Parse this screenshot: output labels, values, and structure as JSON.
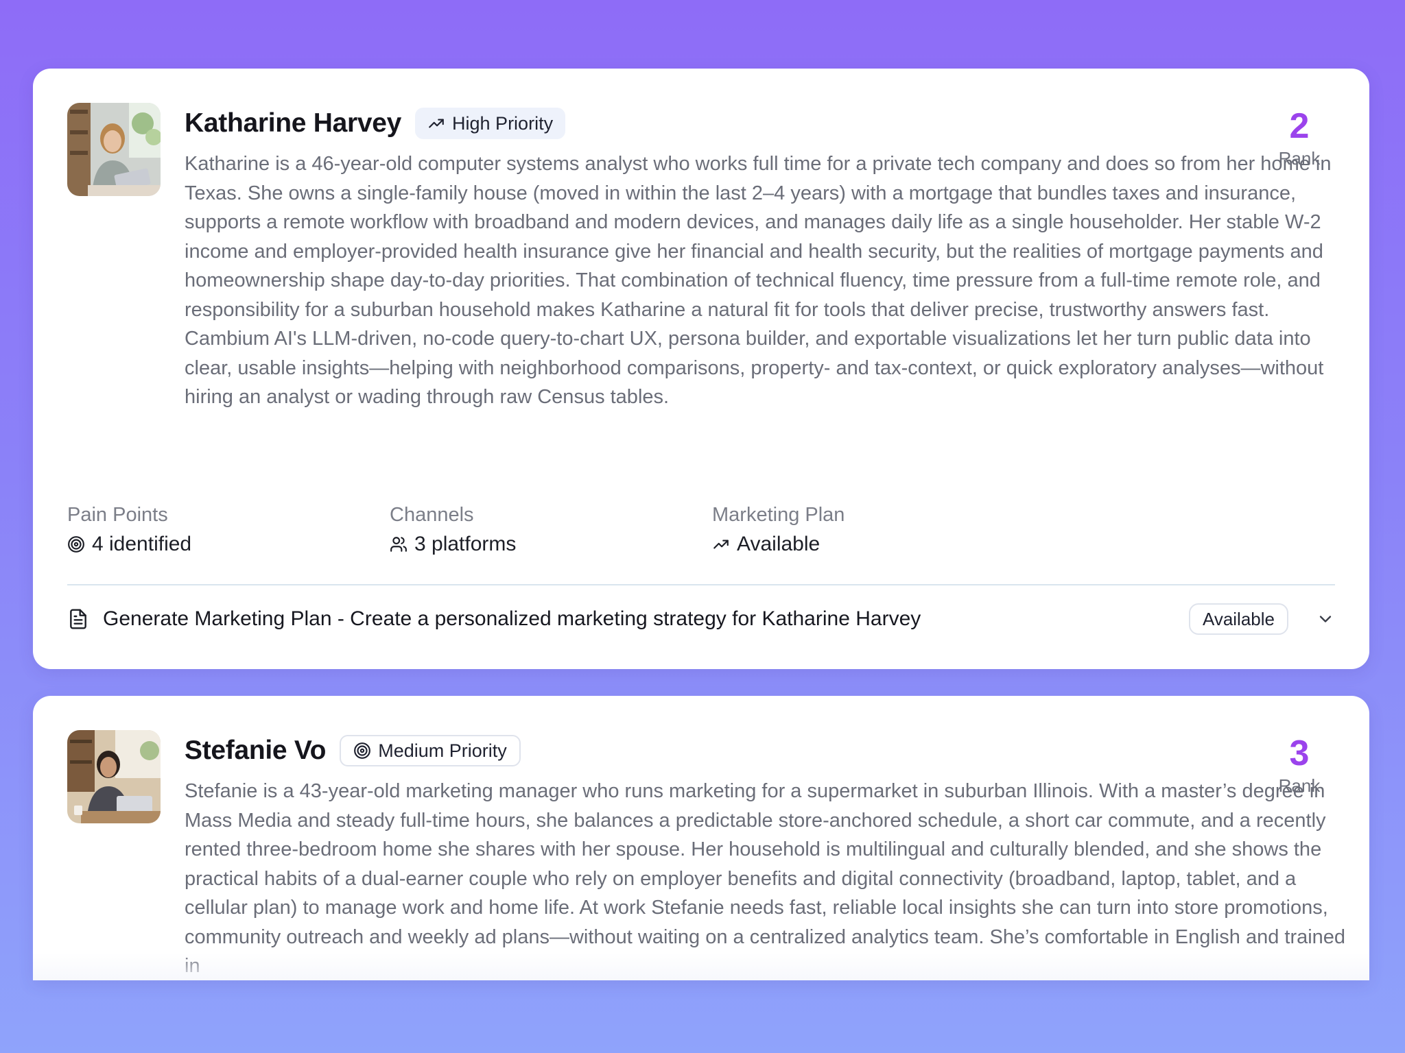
{
  "personas": [
    {
      "name": "Katharine Harvey",
      "priority": "High Priority",
      "priority_icon": "trending-up-icon",
      "rank_value": "2",
      "rank_label": "Rank",
      "description": "Katharine is a 46-year-old computer systems analyst who works full time for a private tech company and does so from her home in Texas. She owns a single-family house (moved in within the last 2–4 years) with a mortgage that bundles taxes and insurance, supports a remote workflow with broadband and modern devices, and manages daily life as a single householder. Her stable W-2 income and employer-provided health insurance give her financial and health security, but the realities of mortgage payments and homeownership shape day-to-day priorities. That combination of technical fluency, time pressure from a full-time remote role, and responsibility for a suburban household makes Katharine a natural fit for tools that deliver precise, trustworthy answers fast. Cambium AI's LLM-driven, no-code query-to-chart UX, persona builder, and exportable visualizations let her turn public data into clear, usable insights—helping with neighborhood comparisons, property- and tax-context, or quick exploratory analyses—without hiring an analyst or wading through raw Census tables.",
      "stats": [
        {
          "label": "Pain Points",
          "value": "4 identified",
          "icon": "target-icon"
        },
        {
          "label": "Channels",
          "value": "3 platforms",
          "icon": "users-icon"
        },
        {
          "label": "Marketing Plan",
          "value": "Available",
          "icon": "trending-up-icon"
        }
      ],
      "plan_title": "Generate Marketing Plan - Create a personalized marketing strategy for Katharine Harvey",
      "plan_status": "Available"
    },
    {
      "name": "Stefanie Vo",
      "priority": "Medium Priority",
      "priority_icon": "target-icon",
      "rank_value": "3",
      "rank_label": "Rank",
      "description": "Stefanie is a 43-year-old marketing manager who runs marketing for a supermarket in suburban Illinois. With a master’s degree in Mass Media and steady full-time hours, she balances a predictable store-anchored schedule, a short car commute, and a recently rented three-bedroom home she shares with her spouse. Her household is multilingual and culturally blended, and she shows the practical habits of a dual-earner couple who rely on employer benefits and digital connectivity (broadband, laptop, tablet, and a cellular plan) to manage work and home life. At work Stefanie needs fast, reliable local insights she can turn into store promotions, community outreach and weekly ad plans—without waiting on a centralized analytics team. She’s comfortable in English and trained in"
    }
  ],
  "colors": {
    "rank": "#9b43ec",
    "background_top": "#8e6cf7",
    "background_bottom": "#8fa3fb"
  }
}
